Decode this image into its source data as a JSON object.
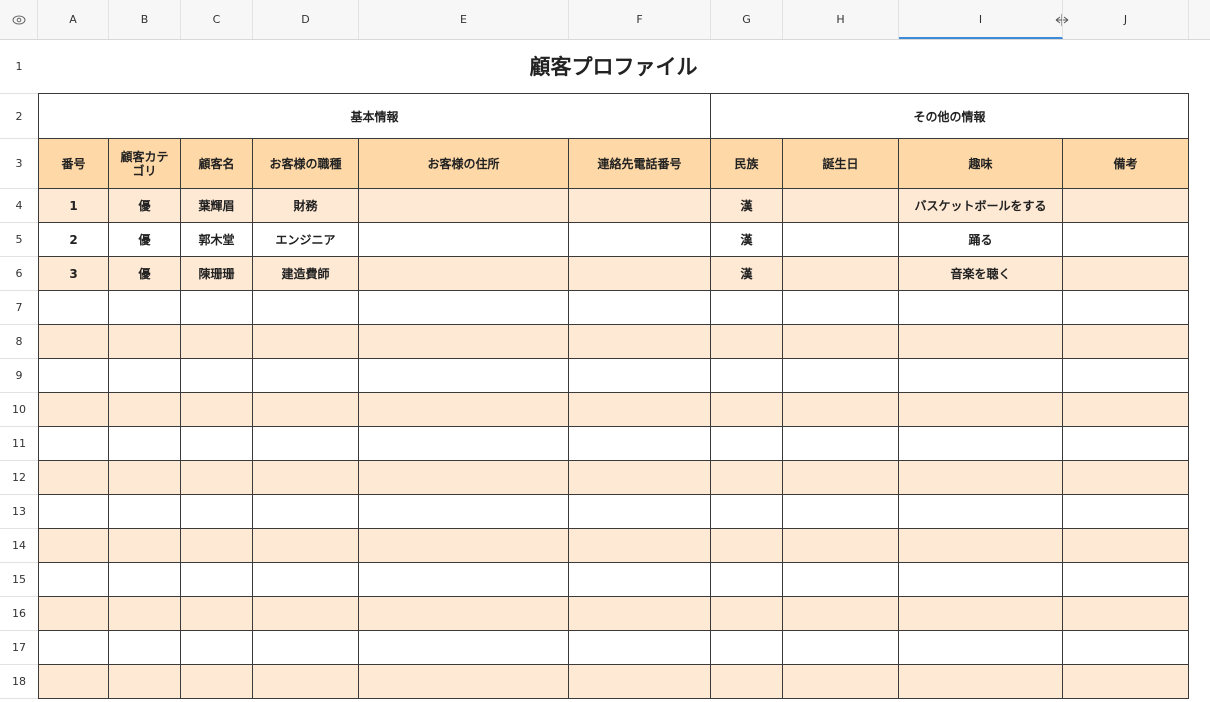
{
  "columns": [
    "A",
    "B",
    "C",
    "D",
    "E",
    "F",
    "G",
    "H",
    "I",
    "J"
  ],
  "rows": [
    "1",
    "2",
    "3",
    "4",
    "5",
    "6",
    "7",
    "8",
    "9",
    "10",
    "11",
    "12",
    "13",
    "14",
    "15",
    "16",
    "17",
    "18"
  ],
  "title": "顧客プロファイル",
  "groups": {
    "basic": "基本情報",
    "other": "その他の情報"
  },
  "headers": [
    "番号",
    "顧客カテゴリ",
    "顧客名",
    "お客様の職種",
    "お客様の住所",
    "連絡先電話番号",
    "民族",
    "誕生日",
    "趣味",
    "備考"
  ],
  "records": [
    [
      "1",
      "優",
      "葉輝眉",
      "財務",
      "",
      "",
      "漢",
      "",
      "バスケットボールをする",
      ""
    ],
    [
      "2",
      "優",
      "郭木堂",
      "エンジニア",
      "",
      "",
      "漢",
      "",
      "踊る",
      ""
    ],
    [
      "3",
      "優",
      "陳珊珊",
      "建造費師",
      "",
      "",
      "漢",
      "",
      "音楽を聴く",
      ""
    ]
  ],
  "colors": {
    "header_fill": "#fed8a6",
    "band_fill": "#fde9d4",
    "selection": "#3d8bd6"
  },
  "icons": {
    "corner": "eye-icon",
    "cursor": "column-resize-icon"
  }
}
